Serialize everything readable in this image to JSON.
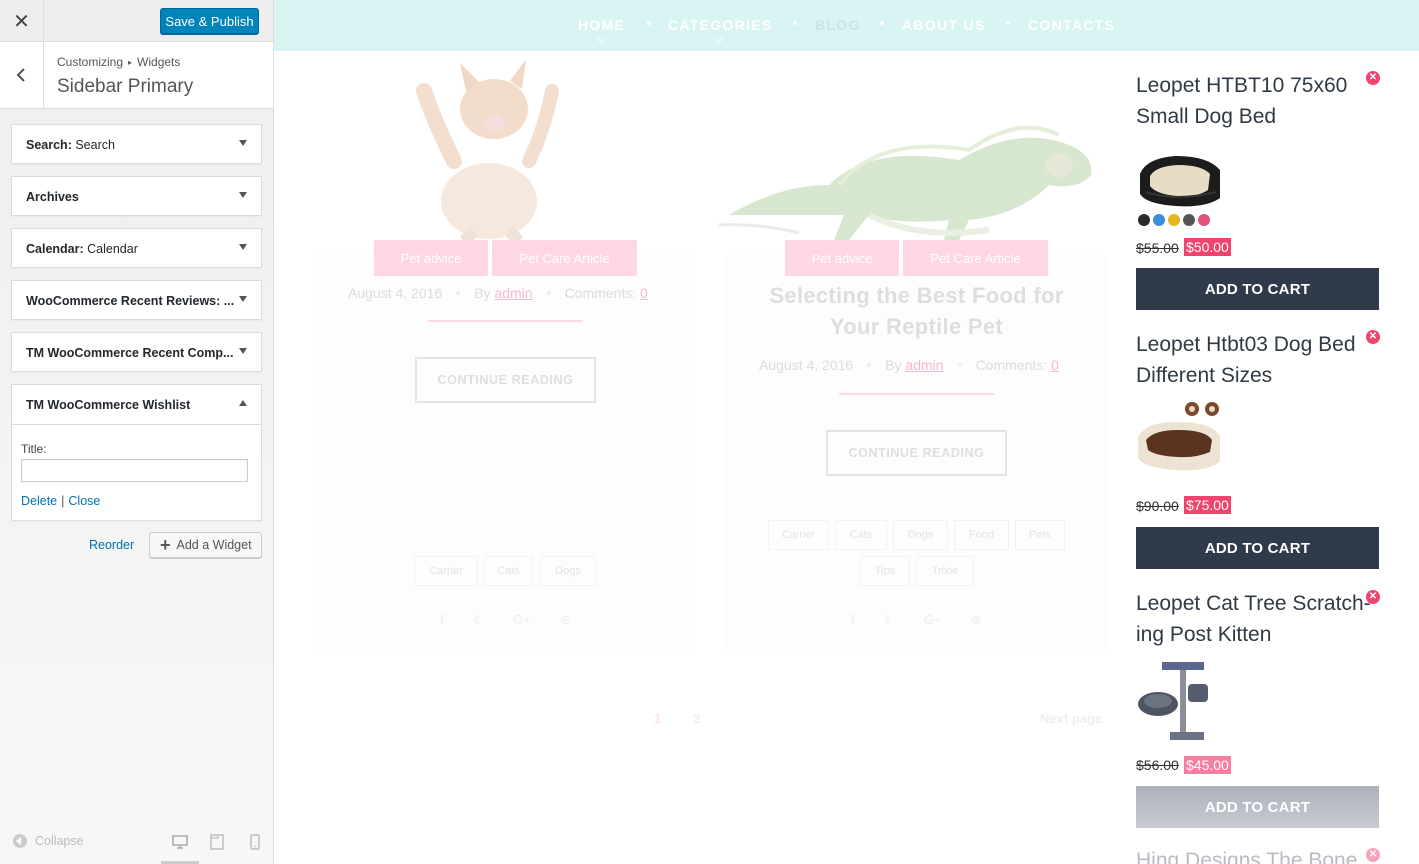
{
  "customizer": {
    "close_icon": "✕",
    "publish_label": "Save & Publish",
    "breadcrumb_root": "Customizing",
    "breadcrumb_arrow": "▸",
    "breadcrumb_section": "Widgets",
    "section_title": "Sidebar Primary",
    "widgets": [
      {
        "name": "Search:",
        "title": " Search"
      },
      {
        "name": "Archives",
        "title": ""
      },
      {
        "name": "Calendar:",
        "title": " Calendar"
      },
      {
        "name": "WooCommerce Recent Reviews: ...",
        "title": ""
      },
      {
        "name": "TM WooCommerce Recent Comp...",
        "title": ""
      },
      {
        "name": "TM WooCommerce Wishlist",
        "title": ""
      }
    ],
    "open_widget": {
      "field_label": "Title:",
      "field_value": "",
      "delete_label": "Delete",
      "separator": "|",
      "close_label": "Close"
    },
    "reorder_label": "Reorder",
    "add_widget_label": "Add a Widget",
    "collapse_label": "Collapse"
  },
  "preview": {
    "nav": [
      {
        "label": "HOME",
        "has_sub": true
      },
      {
        "label": "CATEGORIES",
        "has_sub": true
      },
      {
        "label": "BLOG",
        "has_sub": false
      },
      {
        "label": "ABOUT US",
        "has_sub": false
      },
      {
        "label": "CONTACTS",
        "has_sub": false
      }
    ],
    "posts": [
      {
        "tags": [
          "Pet advice",
          "Pet Care Article"
        ],
        "date": "August 4, 2016",
        "by": "By",
        "author": "admin",
        "comments": "Comments:",
        "comments_count": "0",
        "title": "",
        "continue": "CONTINUE READING",
        "post_tags": [
          "Carrier",
          "Cats",
          "Dogs"
        ]
      },
      {
        "tags": [
          "Pet advice",
          "Pet Care Article"
        ],
        "date": "August 4, 2016",
        "by": "By",
        "author": "admin",
        "comments": "Comments:",
        "comments_count": "0",
        "title_line1": "Selecting the Best Food for",
        "title_line2": "Your Reptile Pet",
        "continue": "CONTINUE READING",
        "post_tags_row1": [
          "Carrier",
          "Cats",
          "Dogs",
          "Food",
          "Pets"
        ],
        "post_tags_row2": [
          "Tips",
          "Trixie"
        ]
      }
    ],
    "share_icons": [
      "f",
      "𝕥",
      "G+",
      "⊕"
    ],
    "pagination": {
      "page1": "1",
      "page2": "2",
      "next": "Next page"
    },
    "wishlist": [
      {
        "title_line1": "Leopet HTBT10 75x60",
        "title_line2": "Small Dog Bed",
        "old_price": "$55.00",
        "new_price": "$50.00",
        "button": "ADD TO CART",
        "swatch_colors": [
          "#2b2b2b",
          "#3a8fd8",
          "#e6b81f",
          "#555555",
          "#e2527c"
        ]
      },
      {
        "title_line1": "Leopet Htbt03 Dog Bed",
        "title_line2": "Different Sizes",
        "old_price": "$90.00",
        "new_price": "$75.00",
        "button": "ADD TO CART"
      },
      {
        "title_line1": "Leopet Cat Tree Scratch-",
        "title_line2": "ing Post Kitten",
        "old_price": "$56.00",
        "new_price": "$45.00",
        "button": "ADD TO CART"
      },
      {
        "title_line1": "Hing Designs The Bone"
      }
    ],
    "remove_icon": "✕"
  },
  "colors": {
    "publish_blue": "#0085ba",
    "link_blue": "#0073aa",
    "nav_bg": "#d9f5f3",
    "sale_pink": "#f0446f",
    "cart_dark": "#2f3a4a"
  }
}
